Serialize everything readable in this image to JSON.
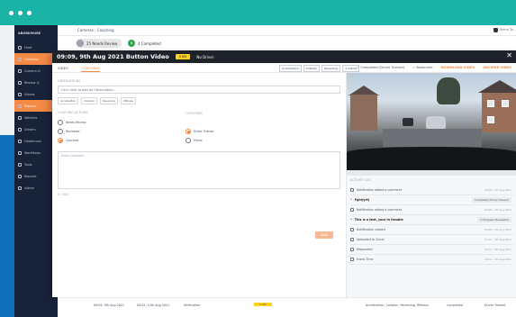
{
  "sidebar": {
    "brand": "ABORKMURE",
    "items": [
      {
        "label": "Fleet",
        "active": false
      },
      {
        "label": "Cameras",
        "active": true
      },
      {
        "label": "Camera H.",
        "active": false
      },
      {
        "label": "Review Q.",
        "active": false
      },
      {
        "label": "Videos",
        "active": false
      },
      {
        "label": "Reports",
        "active": true
      },
      {
        "label": "Vehicles",
        "active": false
      },
      {
        "label": "Drivers",
        "active": false
      },
      {
        "label": "Geofences",
        "active": false
      },
      {
        "label": "Workflows",
        "active": false
      },
      {
        "label": "Tools",
        "active": false
      },
      {
        "label": "Reports",
        "active": false
      },
      {
        "label": "Admin",
        "active": false
      }
    ]
  },
  "topbar": {
    "breadcrumb": "Cameras › Coaching",
    "user": "Demo Ta..."
  },
  "status_strip": {
    "needs_review": "25 Needs Review",
    "completed_badge": "N",
    "completed": "4 Completed"
  },
  "modal": {
    "title": "09:09, 9th Aug 2021  Button Video",
    "speed_badge": "0 KM",
    "driver": "No Driver",
    "close": "✕",
    "tabs": [
      {
        "label": "VIDEO",
        "active": false
      },
      {
        "label": "COACHING",
        "active": true
      }
    ],
    "tags": [
      "Acceleration",
      "Collision",
      "Reversing",
      "1 Interal"
    ],
    "toolbar": {
      "completed": "Completed (Driver Trained)",
      "bookmark": "Bookmark",
      "download": "DOWNLOAD VIDEO",
      "archive": "ARCHIVE VIDEO"
    }
  },
  "coaching": {
    "observations_label": "OBSERVATIONS",
    "observation_placeholder": "Click here to add an Observation...",
    "chips": [
      "Acceleration",
      "Collision",
      "Reversing",
      "Witness"
    ],
    "actions_label": "COACHING ACTIONS",
    "outcomes_label": "OUTCOMES",
    "actions": [
      {
        "label": "Needs Review",
        "checked": false
      },
      {
        "label": "Reviewed",
        "checked": false
      },
      {
        "label": "Coached",
        "checked": true
      }
    ],
    "outcomes": [
      {
        "label": "Driver Trained",
        "checked": true
      },
      {
        "label": "Praise",
        "checked": false
      }
    ],
    "comment_placeholder": "Enter comment",
    "counter": "0 / 500",
    "save": "Save"
  },
  "activity": {
    "label": "ACTIVITY LOG",
    "rows": [
      {
        "text": "Notification added a comment",
        "time": "09:09 - 9th Aug 2021"
      },
      {
        "text": "Fghrjyrtj",
        "sub": true,
        "tag": "Completed (Driver Trained)"
      },
      {
        "text": "Notification added a comment",
        "time": "09:09 - 9th Aug 2021"
      },
      {
        "text": "This is a test, your in trouble",
        "sub": true,
        "tag": "In Progress (Reviewed)"
      },
      {
        "text": "Notification viewed",
        "time": "09:09 - 9th Aug 2021"
      },
      {
        "text": "Uploaded to Cloud",
        "time": "09:10 - 9th Aug 2021"
      },
      {
        "text": "Requested",
        "time": "09:10 - 9th Aug 2021"
      },
      {
        "text": "Event Time",
        "time": "09:10 - 9th Aug 2021"
      }
    ]
  },
  "table_row": {
    "time": "09:09, 9th Aug 2021",
    "created": "09:42, 12th Aug 2021",
    "type": "Verification",
    "speed": "0 KM",
    "tags": "Acceleration, Collision, Reversing, Witness",
    "status": "Completed",
    "outcome": "Driver Trained"
  }
}
